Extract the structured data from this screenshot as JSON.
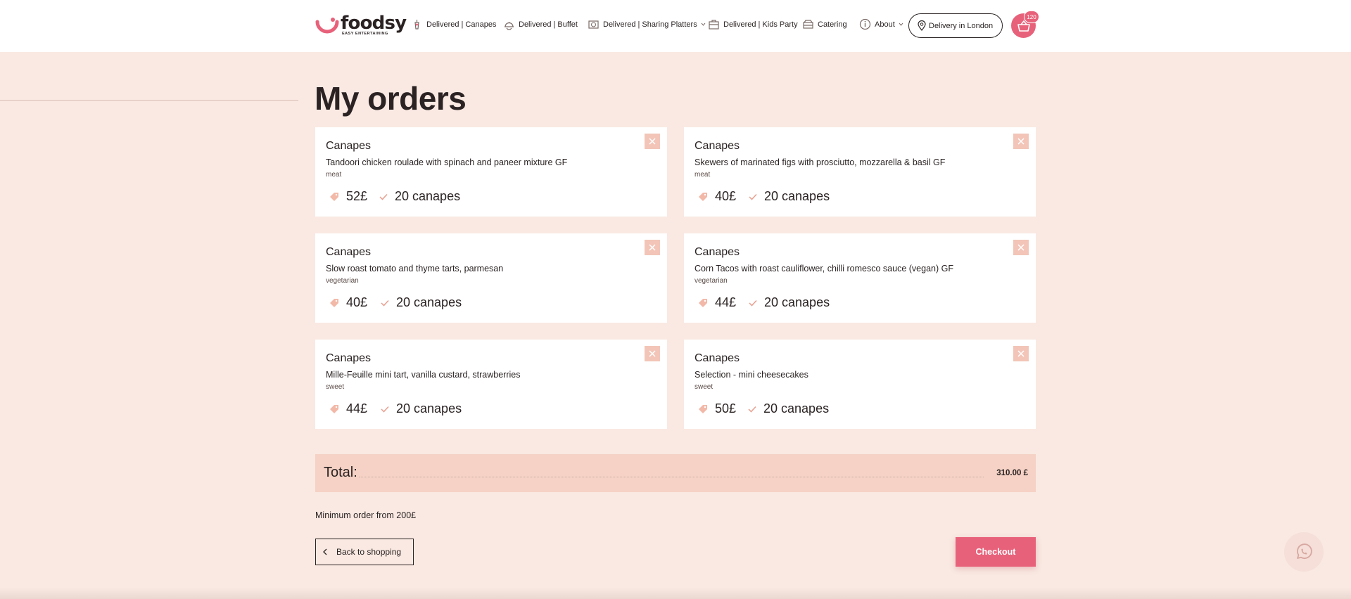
{
  "header": {
    "logo": {
      "name": "foodsy",
      "tagline": "EASY ENTERTAINING"
    },
    "nav": [
      {
        "label": "Delivered | Canapes",
        "icon": "canape-icon"
      },
      {
        "label": "Delivered | Buffet",
        "icon": "cloche-icon"
      },
      {
        "label": "Delivered | Sharing Platters",
        "icon": "platter-icon",
        "dropdown": true
      },
      {
        "label": "Delivered | Kids Party",
        "icon": "lunchbox-icon"
      },
      {
        "label": "Catering",
        "icon": "catering-icon"
      },
      {
        "label": "About",
        "icon": "info-icon",
        "dropdown": true
      }
    ],
    "delivery_label": "Delivery in London",
    "cart_count": "120"
  },
  "page_title": "My orders",
  "orders": [
    {
      "category": "Canapes",
      "name": "Tandoori chicken roulade with spinach and paneer mixture GF",
      "tag": "meat",
      "price": "52£",
      "quantity": "20 canapes"
    },
    {
      "category": "Canapes",
      "name": "Skewers of marinated figs with prosciutto, mozzarella & basil GF",
      "tag": "meat",
      "price": "40£",
      "quantity": "20 canapes"
    },
    {
      "category": "Canapes",
      "name": "Slow roast tomato and thyme tarts, parmesan",
      "tag": "vegetarian",
      "price": "40£",
      "quantity": "20 canapes"
    },
    {
      "category": "Canapes",
      "name": "Corn Tacos with roast cauliflower, chilli romesco sauce (vegan) GF",
      "tag": "vegetarian",
      "price": "44£",
      "quantity": "20 canapes"
    },
    {
      "category": "Canapes",
      "name": "Mille-Feuille mini tart, vanilla custard, strawberries",
      "tag": "sweet",
      "price": "44£",
      "quantity": "20 canapes"
    },
    {
      "category": "Canapes",
      "name": "Selection - mini cheesecakes",
      "tag": "sweet",
      "price": "50£",
      "quantity": "20 canapes"
    }
  ],
  "total": {
    "label": "Total:",
    "value": "310.00 £"
  },
  "min_order": "Minimum order from 200£",
  "back_label": "Back to shopping",
  "checkout_label": "Checkout",
  "colors": {
    "accent": "#e8617a",
    "page_bg": "#f9e9e2",
    "total_bg": "#f5d2c5",
    "remove_bg": "#f2c5b8"
  }
}
